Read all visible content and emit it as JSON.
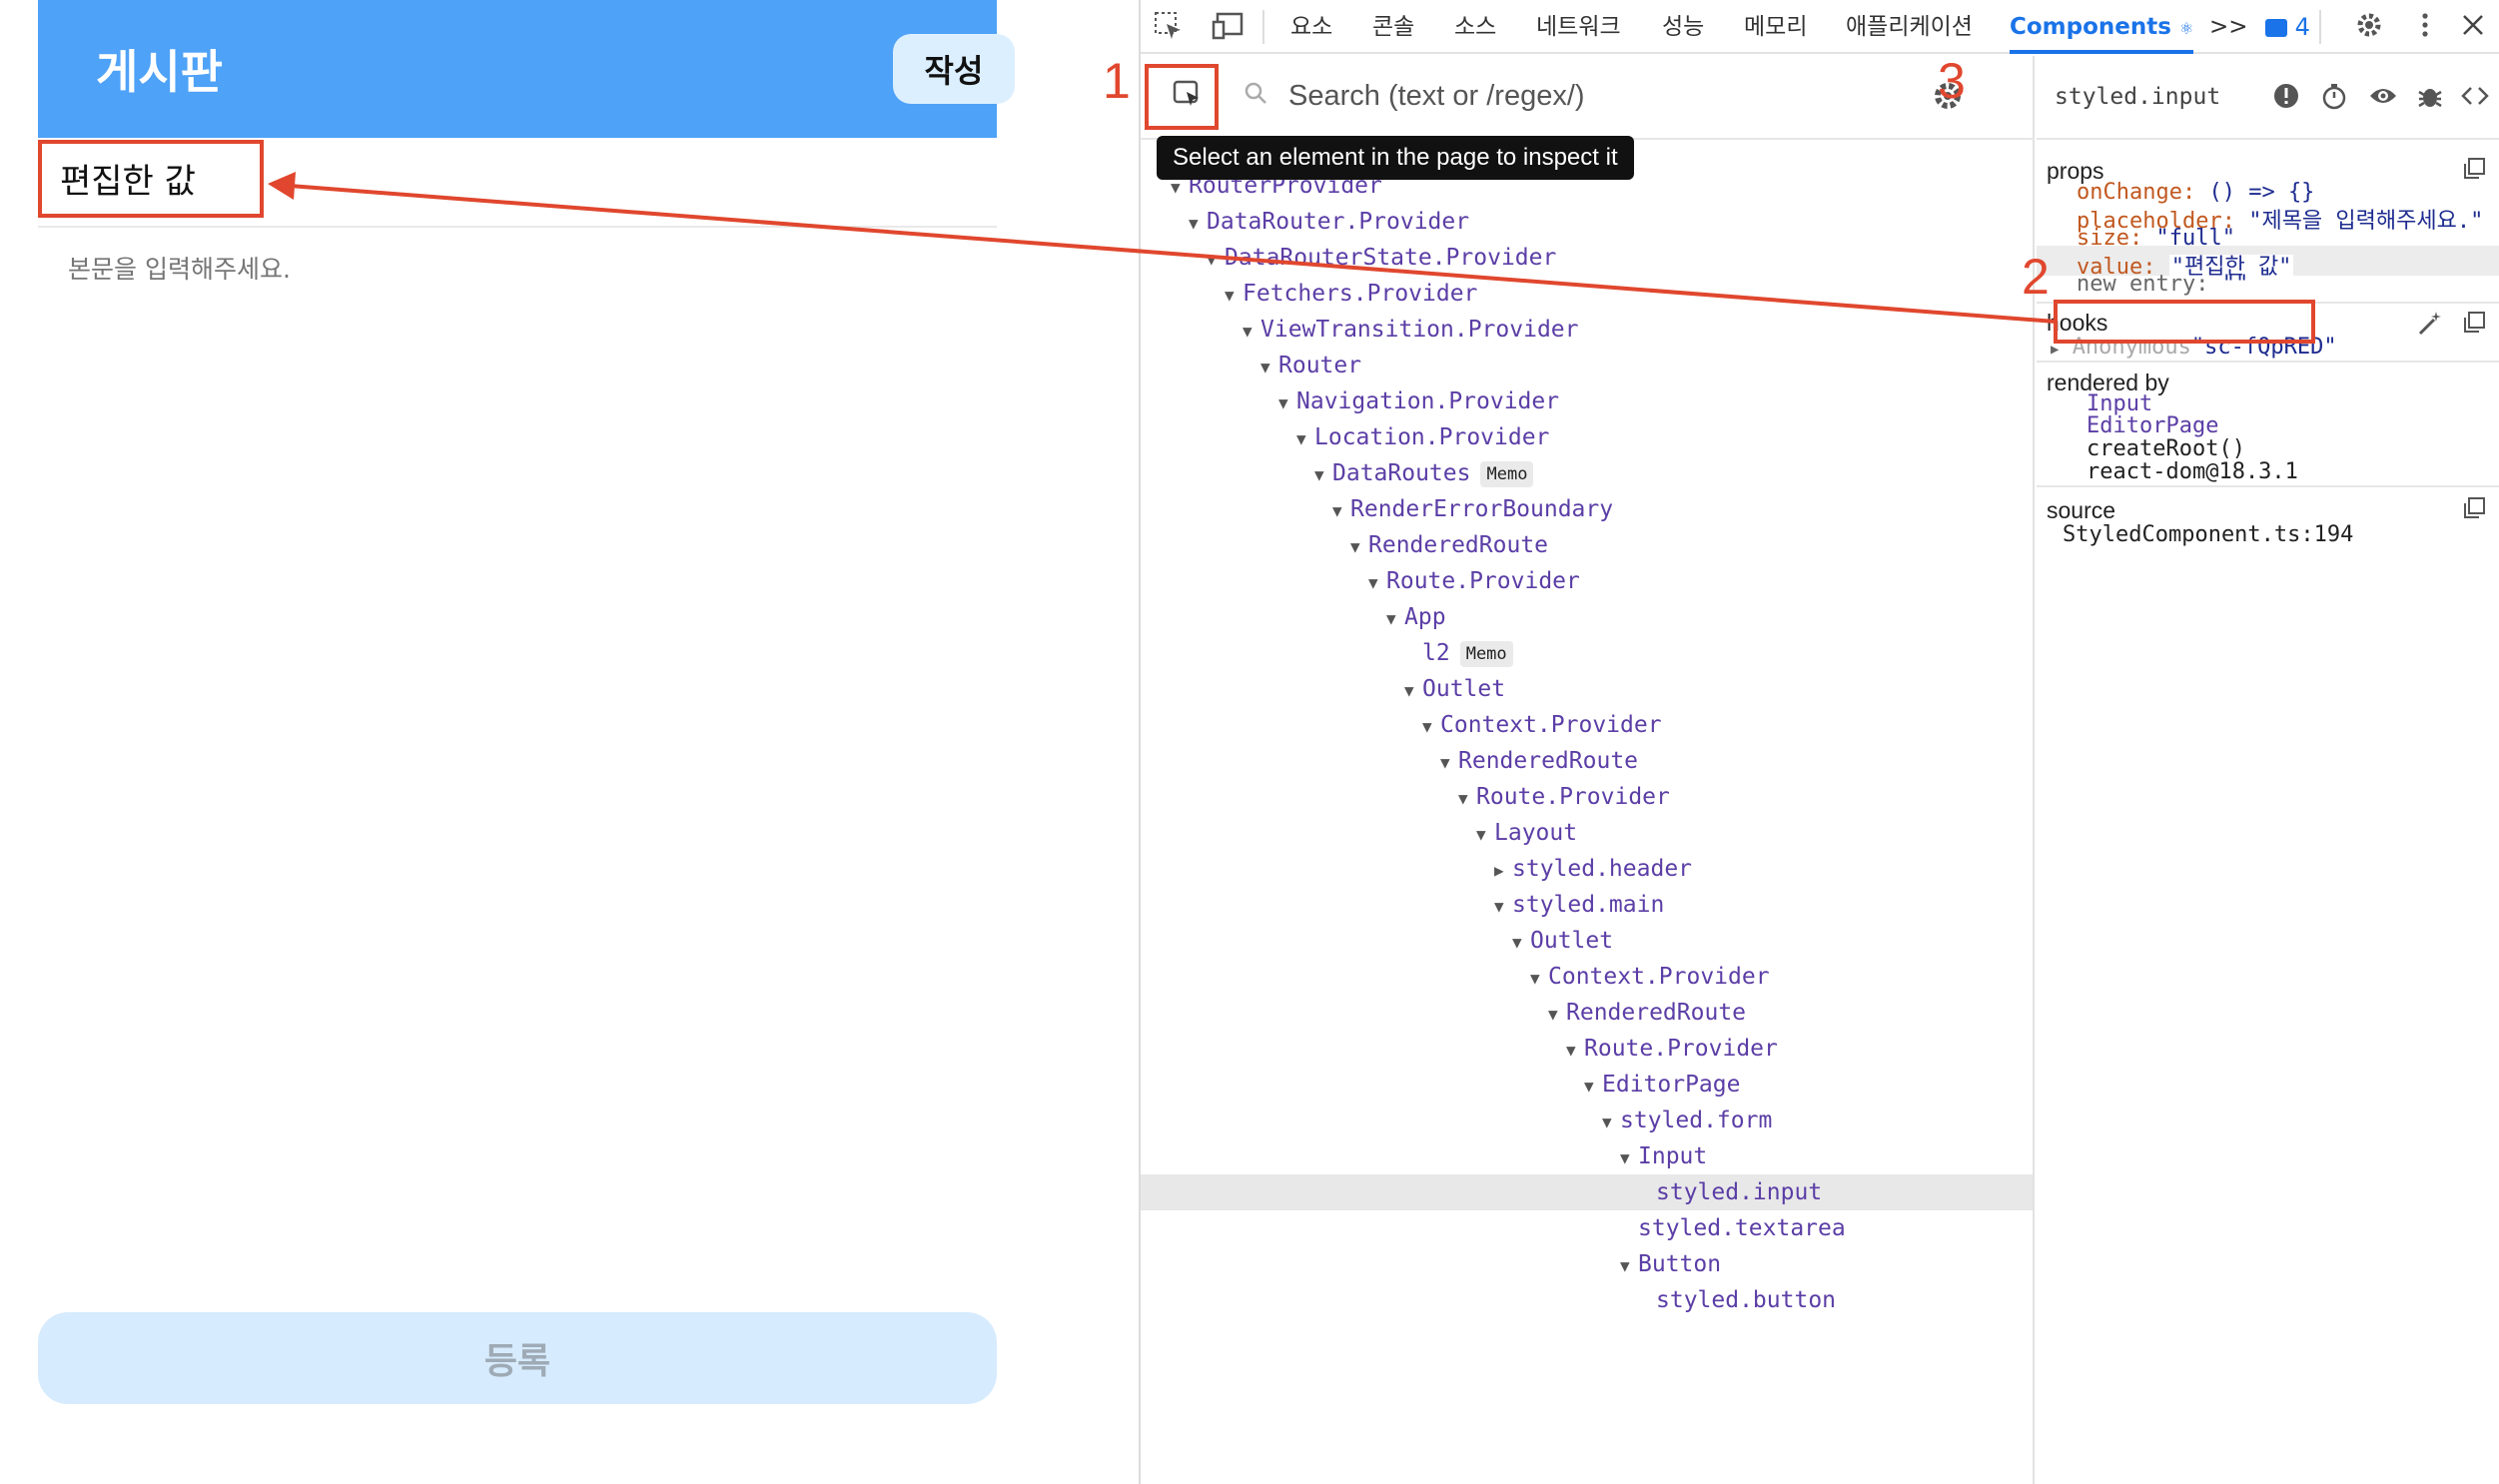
{
  "app": {
    "title": "게시판",
    "write_button": "작성",
    "title_value": "편집한 값",
    "body_placeholder": "본문을 입력해주세요.",
    "submit_button": "등록"
  },
  "devtools": {
    "tabs": [
      "요소",
      "콘솔",
      "소스",
      "네트워크",
      "성능",
      "메모리",
      "애플리케이션",
      "Components"
    ],
    "active_tab": "Components",
    "tab_icon_suffix": "⚛",
    "more_tabs": ">>",
    "issues_count": "4",
    "search_placeholder": "Search (text or /regex/)",
    "inspect_tooltip": "Select an element in the page to inspect it",
    "tree": [
      {
        "name": "RouterProvider",
        "depth": 0,
        "arrow": "down"
      },
      {
        "name": "DataRouter.Provider",
        "depth": 1,
        "arrow": "down"
      },
      {
        "name": "DataRouterState.Provider",
        "depth": 2,
        "arrow": "down"
      },
      {
        "name": "Fetchers.Provider",
        "depth": 3,
        "arrow": "down"
      },
      {
        "name": "ViewTransition.Provider",
        "depth": 4,
        "arrow": "down"
      },
      {
        "name": "Router",
        "depth": 5,
        "arrow": "down"
      },
      {
        "name": "Navigation.Provider",
        "depth": 6,
        "arrow": "down"
      },
      {
        "name": "Location.Provider",
        "depth": 7,
        "arrow": "down"
      },
      {
        "name": "DataRoutes",
        "depth": 8,
        "arrow": "down",
        "badge": "Memo"
      },
      {
        "name": "RenderErrorBoundary",
        "depth": 9,
        "arrow": "down"
      },
      {
        "name": "RenderedRoute",
        "depth": 10,
        "arrow": "down"
      },
      {
        "name": "Route.Provider",
        "depth": 11,
        "arrow": "down"
      },
      {
        "name": "App",
        "depth": 12,
        "arrow": "down"
      },
      {
        "name": "l2",
        "depth": 13,
        "arrow": "none",
        "badge": "Memo"
      },
      {
        "name": "Outlet",
        "depth": 13,
        "arrow": "down"
      },
      {
        "name": "Context.Provider",
        "depth": 14,
        "arrow": "down"
      },
      {
        "name": "RenderedRoute",
        "depth": 15,
        "arrow": "down"
      },
      {
        "name": "Route.Provider",
        "depth": 16,
        "arrow": "down"
      },
      {
        "name": "Layout",
        "depth": 17,
        "arrow": "down"
      },
      {
        "name": "styled.header",
        "depth": 18,
        "arrow": "right"
      },
      {
        "name": "styled.main",
        "depth": 18,
        "arrow": "down"
      },
      {
        "name": "Outlet",
        "depth": 19,
        "arrow": "down"
      },
      {
        "name": "Context.Provider",
        "depth": 20,
        "arrow": "down"
      },
      {
        "name": "RenderedRoute",
        "depth": 21,
        "arrow": "down"
      },
      {
        "name": "Route.Provider",
        "depth": 22,
        "arrow": "down"
      },
      {
        "name": "EditorPage",
        "depth": 23,
        "arrow": "down"
      },
      {
        "name": "styled.form",
        "depth": 24,
        "arrow": "down"
      },
      {
        "name": "Input",
        "depth": 25,
        "arrow": "down"
      },
      {
        "name": "styled.input",
        "depth": 26,
        "arrow": "none",
        "selected": true
      },
      {
        "name": "styled.textarea",
        "depth": 25,
        "arrow": "none"
      },
      {
        "name": "Button",
        "depth": 25,
        "arrow": "down"
      },
      {
        "name": "styled.button",
        "depth": 26,
        "arrow": "none"
      }
    ],
    "detail": {
      "component_name": "styled.input",
      "props_title": "props",
      "props": [
        {
          "key": "onChange",
          "value": "() => {}"
        },
        {
          "key": "placeholder",
          "value": "\"제목을 입력해주세요.\""
        },
        {
          "key": "size",
          "value": "\"full\""
        },
        {
          "key": "value",
          "value": "\"편집한 값\""
        },
        {
          "key": "new entry",
          "value": "\"\""
        }
      ],
      "hooks_title": "hooks",
      "hook_name": "Anonymous",
      "hook_value": "\"sc-fQpRED\"",
      "rendered_by_title": "rendered by",
      "rendered_by": [
        "Input",
        "EditorPage",
        "createRoot()",
        "react-dom@18.3.1"
      ],
      "source_title": "source",
      "source_value": "StyledComponent.ts:194"
    }
  },
  "annotations": {
    "label_1": "1",
    "label_2": "2",
    "label_3": "3",
    "color": "#e0472e"
  }
}
